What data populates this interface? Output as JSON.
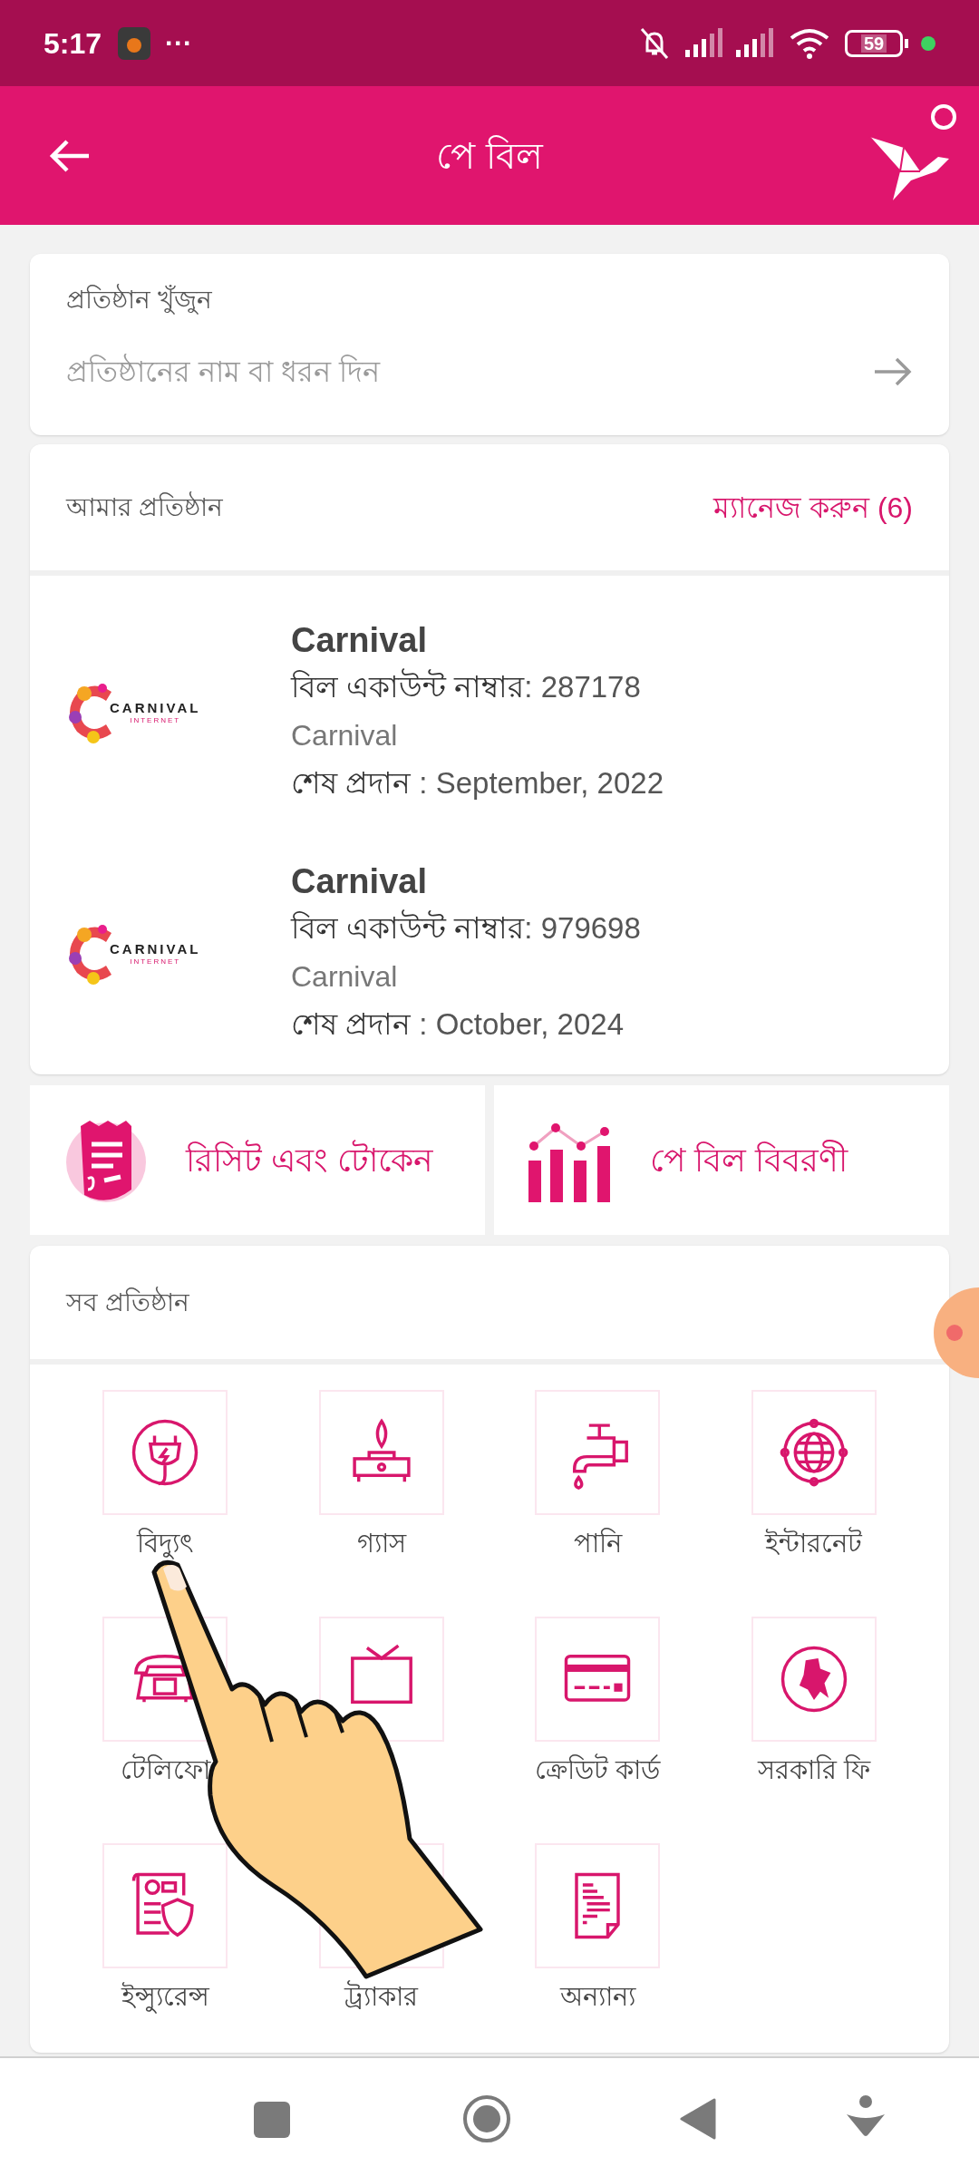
{
  "status_bar": {
    "time": "5:17",
    "dots": "···",
    "battery": "59"
  },
  "header": {
    "title": "পে বিল"
  },
  "search": {
    "label": "প্রতিষ্ঠান খুঁজুন",
    "placeholder": "প্রতিষ্ঠানের নাম বা ধরন দিন"
  },
  "my_institutions": {
    "title": "আমার প্রতিষ্ঠান",
    "manage": "ম্যানেজ করুন (6)",
    "items": [
      {
        "logo_text": "CARNIVAL",
        "logo_subtext": "INTERNET",
        "name": "Carnival",
        "account_label": "বিল একাউন্ট নাম্বার",
        "account_number": ": 287178",
        "provider": "Carnival",
        "last_label": "শেষ প্রদান",
        "last_value": " : September, 2022"
      },
      {
        "logo_text": "CARNIVAL",
        "logo_subtext": "INTERNET",
        "name": "Carnival",
        "account_label": "বিল একাউন্ট নাম্বার",
        "account_number": ": 979698",
        "provider": "Carnival",
        "last_label": "শেষ প্রদান",
        "last_value": " : October, 2024"
      }
    ]
  },
  "shortcuts": [
    {
      "kind": "receipt",
      "label": "রিসিট এবং টোকেন"
    },
    {
      "kind": "chart",
      "label": "পে বিল বিবরণী"
    }
  ],
  "all_institutions": {
    "title": "সব প্রতিষ্ঠান",
    "categories": [
      {
        "kind": "plug",
        "label": "বিদ্যুৎ"
      },
      {
        "kind": "stove",
        "label": "গ্যাস"
      },
      {
        "kind": "tap",
        "label": "পানি"
      },
      {
        "kind": "globe",
        "label": "ইন্টারনেট"
      },
      {
        "kind": "phone",
        "label": "টেলিফো"
      },
      {
        "kind": "tv"
      },
      {
        "kind": "card",
        "label": "ক্রেডিট কার্ড"
      },
      {
        "kind": "map",
        "label": "সরকারি ফি"
      },
      {
        "kind": "insurance",
        "label": "ইন্স্যুরেন্স"
      },
      {
        "kind": "hidden",
        "label": "ট্র্যাকার"
      },
      {
        "kind": "document",
        "label": "অন্যান্য"
      }
    ]
  }
}
